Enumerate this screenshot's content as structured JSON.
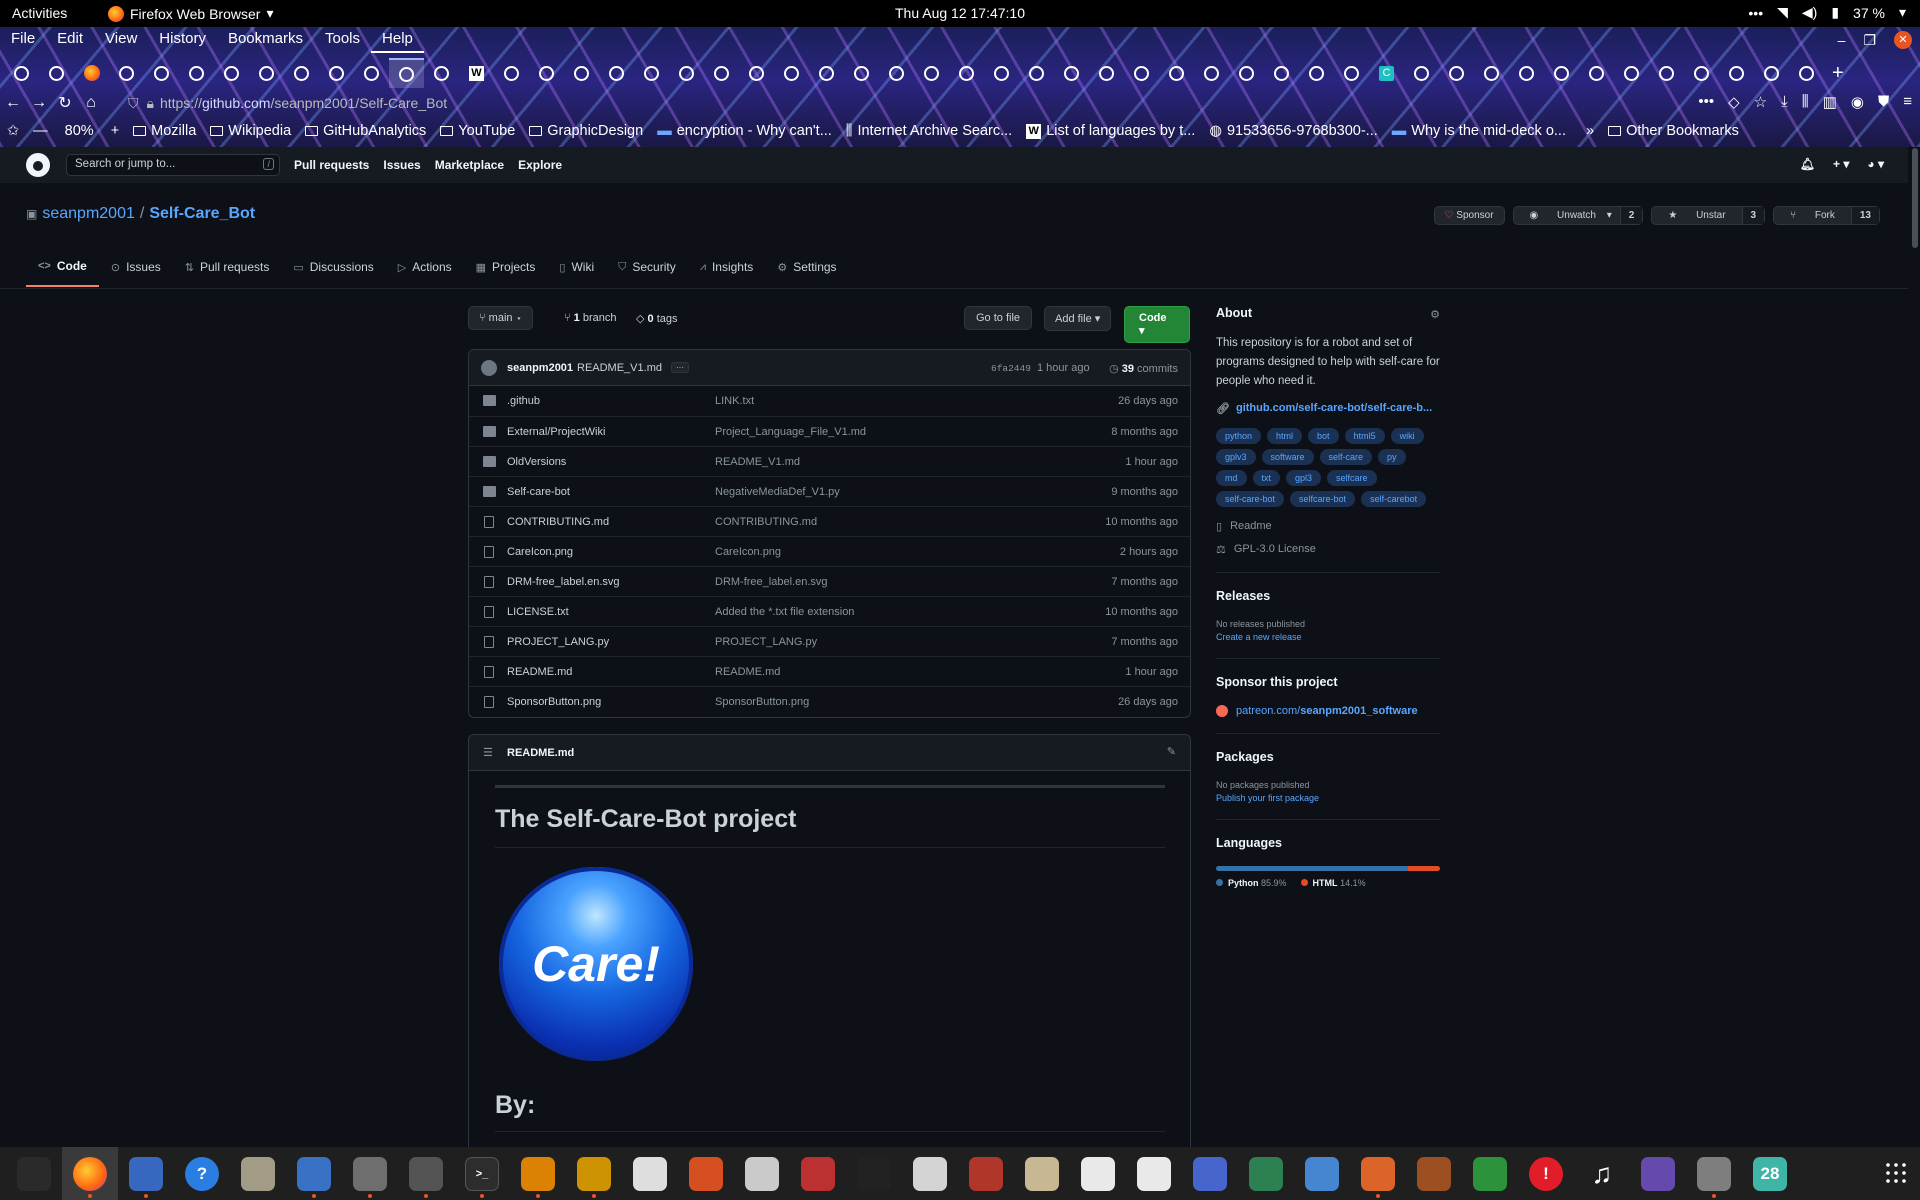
{
  "system": {
    "activities": "Activities",
    "app_name": "Firefox Web Browser",
    "clock": "Thu Aug 12  17:47:10",
    "battery": "37 %"
  },
  "firefox": {
    "menu": [
      "File",
      "Edit",
      "View",
      "History",
      "Bookmarks",
      "Tools",
      "Help"
    ],
    "url_prefix": "https://",
    "url_host": "github.com",
    "url_path": "/seanpm2001/Self-Care_Bot",
    "zoom": "80%",
    "bookmarks": [
      {
        "label": "Mozilla",
        "icon": "folder-icon"
      },
      {
        "label": "Wikipedia",
        "icon": "folder-icon"
      },
      {
        "label": "GitHubAnalytics",
        "icon": "folder-icon"
      },
      {
        "label": "YouTube",
        "icon": "folder-icon"
      },
      {
        "label": "GraphicDesign",
        "icon": "folder-icon"
      },
      {
        "label": "encryption - Why can't...",
        "icon": "stackexchange-icon"
      },
      {
        "label": "Internet Archive Searc...",
        "icon": "archive-icon"
      },
      {
        "label": "List of languages by t...",
        "icon": "wikipedia-icon"
      },
      {
        "label": "91533656-9768b300-...",
        "icon": "globe-icon"
      },
      {
        "label": "Why is the mid-deck o...",
        "icon": "stackexchange-icon"
      }
    ],
    "other_bookmarks": "Other Bookmarks"
  },
  "github": {
    "search_placeholder": "Search or jump to...",
    "search_key": "/",
    "nav": [
      "Pull requests",
      "Issues",
      "Marketplace",
      "Explore"
    ],
    "repo": {
      "owner": "seanpm2001",
      "name": "Self-Care_Bot",
      "separator": "/"
    },
    "actions": {
      "sponsor": "Sponsor",
      "unwatch": "Unwatch",
      "unwatch_count": "2",
      "unstar": "Unstar",
      "star_count": "3",
      "fork": "Fork",
      "fork_count": "13"
    },
    "tabs": [
      "Code",
      "Issues",
      "Pull requests",
      "Discussions",
      "Actions",
      "Projects",
      "Wiki",
      "Security",
      "Insights",
      "Settings"
    ],
    "file_nav": {
      "branch": "main",
      "branch_count": "1",
      "branch_label": "branch",
      "tag_count": "0",
      "tag_label": "tags",
      "go_to_file": "Go to file",
      "add_file": "Add file",
      "code": "Code"
    },
    "latest_commit": {
      "author": "seanpm2001",
      "message": "README_V1.md",
      "more": "···",
      "hash": "6fa2449",
      "time": "1 hour ago",
      "commit_count": "39",
      "commit_label": "commits"
    },
    "files": [
      {
        "name": ".github",
        "type": "dir",
        "message": "LINK.txt",
        "age": "26 days ago"
      },
      {
        "name": "External/ProjectWiki",
        "type": "dir",
        "message": "Project_Language_File_V1.md",
        "age": "8 months ago"
      },
      {
        "name": "OldVersions",
        "type": "dir",
        "message": "README_V1.md",
        "age": "1 hour ago"
      },
      {
        "name": "Self-care-bot",
        "type": "dir",
        "message": "NegativeMediaDef_V1.py",
        "age": "9 months ago"
      },
      {
        "name": "CONTRIBUTING.md",
        "type": "file",
        "message": "CONTRIBUTING.md",
        "age": "10 months ago"
      },
      {
        "name": "CareIcon.png",
        "type": "file",
        "message": "CareIcon.png",
        "age": "2 hours ago"
      },
      {
        "name": "DRM-free_label.en.svg",
        "type": "file",
        "message": "DRM-free_label.en.svg",
        "age": "7 months ago"
      },
      {
        "name": "LICENSE.txt",
        "type": "file",
        "message": "Added the *.txt file extension",
        "age": "10 months ago"
      },
      {
        "name": "PROJECT_LANG.py",
        "type": "file",
        "message": "PROJECT_LANG.py",
        "age": "7 months ago"
      },
      {
        "name": "README.md",
        "type": "file",
        "message": "README.md",
        "age": "1 hour ago"
      },
      {
        "name": "SponsorButton.png",
        "type": "file",
        "message": "SponsorButton.png",
        "age": "26 days ago"
      }
    ],
    "readme": {
      "filename": "README.md",
      "title": "The Self-Care-Bot project",
      "image_text": "Care!",
      "by_heading": "By:"
    },
    "about": {
      "heading": "About",
      "description": "This repository is for a robot and set of programs designed to help with self-care for people who need it.",
      "link": "github.com/self-care-bot/self-care-b...",
      "topics": [
        "python",
        "html",
        "bot",
        "html5",
        "wiki",
        "gplv3",
        "software",
        "self-care",
        "py",
        "md",
        "txt",
        "gpl3",
        "selfcare",
        "self-care-bot",
        "selfcare-bot",
        "self-carebot"
      ],
      "readme_label": "Readme",
      "license_label": "GPL-3.0 License"
    },
    "releases": {
      "heading": "Releases",
      "none": "No releases published",
      "create": "Create a new release"
    },
    "sponsor_project": {
      "heading": "Sponsor this project",
      "link_prefix": "patreon.com/",
      "link_user": "seanpm2001_software"
    },
    "packages": {
      "heading": "Packages",
      "none": "No packages published",
      "publish": "Publish your first package"
    },
    "languages": {
      "heading": "Languages",
      "items": [
        {
          "name": "Python",
          "percent": "85.9%",
          "value": 85.9,
          "color": "#3572A5"
        },
        {
          "name": "HTML",
          "percent": "14.1%",
          "value": 14.1,
          "color": "#e34c26"
        }
      ]
    }
  },
  "dock": {
    "items": [
      "system-monitor-icon",
      "firefox-icon",
      "text-editor-icon",
      "help-icon",
      "files-icon",
      "gedit-icon",
      "settings-icon",
      "gimp-icon",
      "terminal-icon",
      "vlc-icon",
      "calculator-icon",
      "graph-icon",
      "software-center-icon",
      "search-icon",
      "disk-icon",
      "inkscape-icon",
      "document-viewer-icon",
      "texteditor2-icon",
      "archive-icon",
      "font-icon",
      "text-icon",
      "todo-icon",
      "vim-icon",
      "presentation-icon",
      "update-icon",
      "game-icon",
      "spreadsheet-icon",
      "alert-icon",
      "music-icon",
      "screenshot-icon",
      "gnome-icon",
      "calendar-icon"
    ],
    "calendar_day": "28"
  }
}
